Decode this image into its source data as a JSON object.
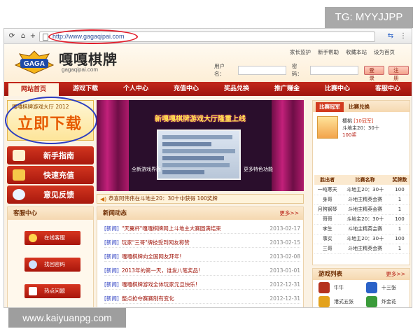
{
  "watermarks": {
    "top": "TG: MYYJJPP",
    "bottom": "www.kaiyuanpg.com"
  },
  "browser": {
    "url": "http://www.gagaqipai.com"
  },
  "site": {
    "logo_badge": "GAGA",
    "logo_title": "嘎嘎棋牌",
    "logo_sub": "gagaqipai.com",
    "top_links": [
      "家长监护",
      "新手帮助",
      "收藏本站",
      "设为首页"
    ],
    "login": {
      "username_label": "用户名：",
      "password_label": "密码：",
      "login_button": "登录",
      "register_button": "注册"
    }
  },
  "nav": [
    "网站首页",
    "游戏下载",
    "个人中心",
    "充值中心",
    "奖品兑换",
    "推广赚金",
    "比赛中心",
    "客服中心"
  ],
  "download": {
    "subtitle": "嘎嘎棋牌游戏大厅 2012",
    "label": "立即下载"
  },
  "quick_buttons": [
    "新手指南",
    "快速充值",
    "意见反馈"
  ],
  "service": {
    "title": "客服中心",
    "buttons": [
      "在线客服",
      "找回密码",
      "热点问题"
    ]
  },
  "banner": {
    "title": "新嘎嘎棋牌游戏大厅隆重上线",
    "caption_left": "全新游戏界面",
    "caption_right": "更多特色功能"
  },
  "ticker": "恭喜阿伟伟在斗地主20：30十中获得 100奖牌",
  "news": {
    "title": "新闻动态",
    "more": "更多>>",
    "items": [
      {
        "tag": "[新闻]",
        "title": "\"天翼杯\"嘎嘎棋牌网上斗地主大赛圆满结束",
        "date": "2013-02-17"
      },
      {
        "tag": "[新闻]",
        "title": "玩家\"三哥\"牌技受到网友称赞",
        "date": "2013-02-15"
      },
      {
        "tag": "[新闻]",
        "title": "嘎嘎棋牌向全国网友拜年!",
        "date": "2013-02-08"
      },
      {
        "tag": "[新闻]",
        "title": "2013年的第一天，谁发八笔奖品!",
        "date": "2013-01-01"
      },
      {
        "tag": "[新闻]",
        "title": "嘎嘎棋牌游戏全体玩家元旦快乐!",
        "date": "2012-12-31"
      },
      {
        "tag": "[新闻]",
        "title": "整点抢夺赛赛制有变化",
        "date": "2012-12-31"
      }
    ]
  },
  "rank": {
    "tabs": [
      "比赛冠军",
      "比赛兑换"
    ],
    "champion": {
      "name": "樱桃",
      "badge": "[10冠军]",
      "game": "斗地主20：30十",
      "score": "100奖"
    },
    "headers": [
      "胜出者",
      "比赛名称",
      "奖牌数"
    ],
    "rows": [
      [
        "一吨寒天",
        "斗地主20：30十",
        "100"
      ],
      [
        "身哥",
        "斗地主精英会赛",
        "1"
      ],
      [
        "月狗钢琴",
        "斗地主精英会赛",
        "1"
      ],
      [
        "哥哥",
        "斗地主20：30十",
        "100"
      ],
      [
        "李生",
        "斗地主精英会赛",
        "1"
      ],
      [
        "事实",
        "斗地主20：30十",
        "100"
      ],
      [
        "三哥",
        "斗地主精英会赛",
        "1"
      ]
    ]
  },
  "games": {
    "title": "游戏列表",
    "more": "更多>>",
    "items": [
      "牛牛",
      "十三张",
      "港式五张",
      "炸金花"
    ]
  }
}
